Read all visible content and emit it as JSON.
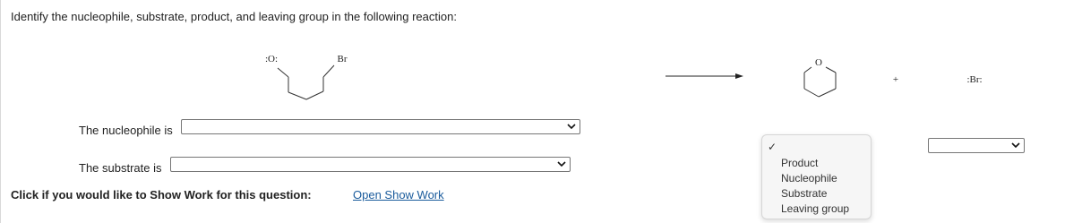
{
  "question": {
    "text": "Identify the nucleophile, substrate, product, and leaving group in the following reaction:"
  },
  "reaction": {
    "oxygen_anion_label": ":O:",
    "bromine_label": "Br",
    "ring_oxygen_label": "O",
    "plus_sign": "+",
    "bromide_label": ":Br:"
  },
  "form": {
    "nucleophile_label": "The nucleophile is",
    "substrate_label": "The substrate is",
    "nucleophile_value": "",
    "substrate_value": "",
    "right_select_value": ""
  },
  "show_work": {
    "prompt": "Click if you would like to Show Work for this question:",
    "link": "Open Show Work"
  },
  "dropdown": {
    "options": [
      "Product",
      "Nucleophile",
      "Substrate",
      "Leaving group"
    ],
    "checkmark": "✓"
  }
}
